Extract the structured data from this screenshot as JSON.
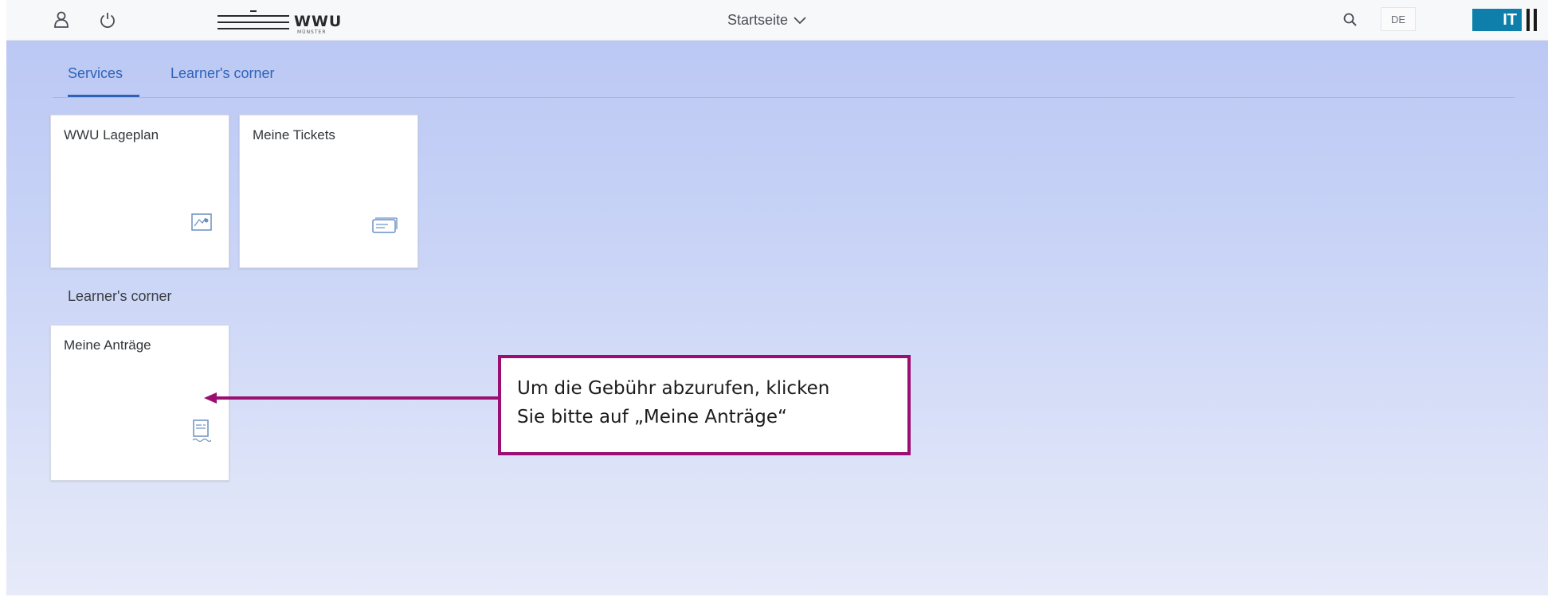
{
  "shell": {
    "icons": {
      "user": "user-icon",
      "power": "power-icon",
      "search": "search-icon",
      "chevron": "chevron-down-icon"
    },
    "logo": {
      "text": "WWU",
      "subtext": "MÜNSTER"
    },
    "title": "Startseite",
    "language": "DE",
    "it_logo": "IT"
  },
  "tabs": [
    {
      "label": "Services",
      "selected": true
    },
    {
      "label": "Learner's corner",
      "selected": false
    }
  ],
  "tiles": [
    {
      "title": "WWU Lageplan",
      "icon": "map-icon"
    },
    {
      "title": "Meine Tickets",
      "icon": "ticket-icon"
    }
  ],
  "section": {
    "title": "Learner's corner"
  },
  "learner_tiles": [
    {
      "title": "Meine Anträge",
      "icon": "receipt-icon"
    }
  ],
  "annotation": {
    "line1": "Um die Gebühr abzurufen, klicken",
    "line2": "Sie bitte auf „Meine Anträge“"
  },
  "colors": {
    "accent": "#2e63b8",
    "annotation_border": "#9b0f73",
    "it_blue": "#0d7faa",
    "background_top": "#b9c6f3",
    "background_bottom": "#e6eaf9"
  }
}
